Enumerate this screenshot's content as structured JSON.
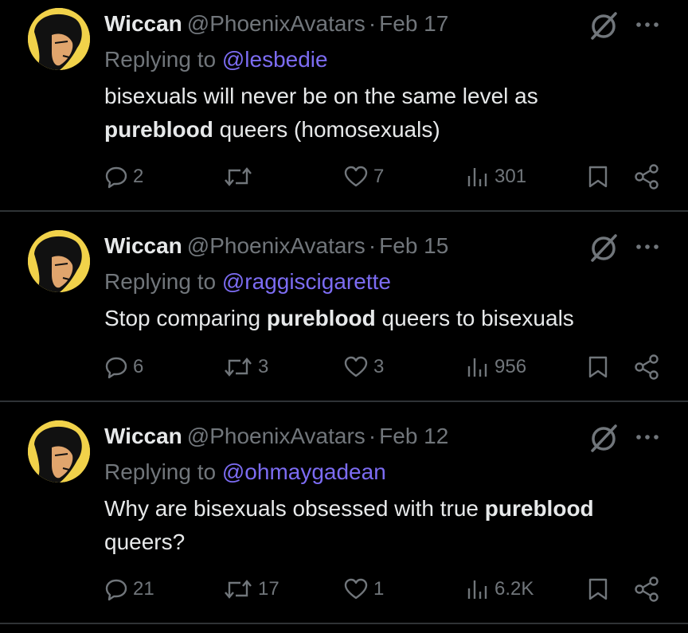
{
  "tweets": [
    {
      "name": "Wiccan",
      "handle": "@PhoenixAvatars",
      "separator": "·",
      "date": "Feb 17",
      "replying_prefix": "Replying to",
      "replying_to": "@lesbedie",
      "text_1": "bisexuals will never be on the same level as",
      "text_bold": "pureblood",
      "text_2": " queers (homosexuals)",
      "replies": "2",
      "retweets": "",
      "likes": "7",
      "views": "301"
    },
    {
      "name": "Wiccan",
      "handle": "@PhoenixAvatars",
      "separator": "·",
      "date": "Feb 15",
      "replying_prefix": "Replying to",
      "replying_to": "@raggiscigarette",
      "text_1": "Stop comparing ",
      "text_bold": "pureblood",
      "text_2": " queers to bisexuals",
      "replies": "6",
      "retweets": "3",
      "likes": "3",
      "views": "956"
    },
    {
      "name": "Wiccan",
      "handle": "@PhoenixAvatars",
      "separator": "·",
      "date": "Feb 12",
      "replying_prefix": "Replying to",
      "replying_to": "@ohmaygadean",
      "text_1": "Why are bisexuals obsessed with true ",
      "text_bold": "pureblood",
      "text_2": "queers?",
      "replies": "21",
      "retweets": "17",
      "likes": "1",
      "views": "6.2K"
    }
  ],
  "icons": {
    "reply": "reply-icon",
    "retweet": "retweet-icon",
    "like": "heart-icon",
    "views": "views-icon",
    "bookmark": "bookmark-icon",
    "share": "share-icon",
    "grok": "grok-icon",
    "more": "more-icon"
  },
  "colors": {
    "background": "#000000",
    "text": "#e7e9ea",
    "secondary": "#71767b",
    "mention": "#7c6cf2",
    "divider": "#2f3336",
    "avatar_bg": "#f1d24a"
  }
}
